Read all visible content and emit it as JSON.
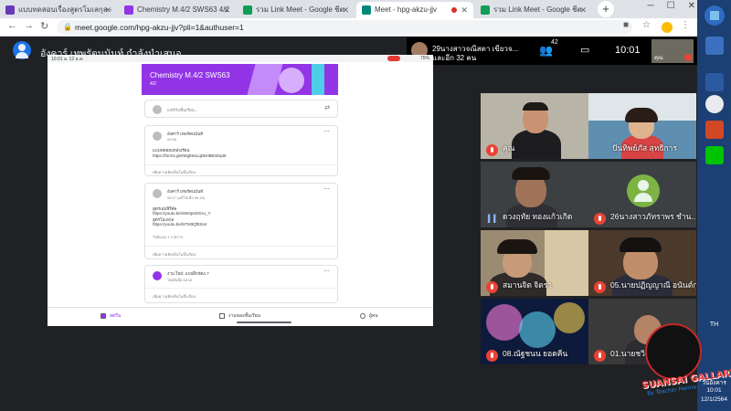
{
  "browser": {
    "tabs": [
      {
        "title": "แบบทดสอบเรื่องสูตรโมเลกุล - ",
        "favicon_color": "#673ab7"
      },
      {
        "title": "Chemistry M.4/2 SWS63 4/2",
        "favicon_color": "#9334e6"
      },
      {
        "title": "รวม Link Meet - Google ชีต",
        "favicon_color": "#0f9d58"
      },
      {
        "title": "Meet - hpg-akzu-jjv",
        "favicon_color": "#00897b",
        "active": true
      },
      {
        "title": "รวม Link Meet - Google ชีต",
        "favicon_color": "#0f9d58"
      }
    ],
    "new_tab": "+",
    "window_buttons": [
      "─",
      "☐",
      "✕"
    ],
    "url": "meet.google.com/hpg-akzu-jjv?pli=1&authuser=1"
  },
  "meet": {
    "presenter_label": "อังคาร์ เทพรัตนนันท์ กำลังนำเสนอ",
    "notification": {
      "line1": "29นางสาวจณีสตา เขียวจ...",
      "line2": "และอีก 32 คน"
    },
    "people_count": "42",
    "clock": "10:01",
    "self_name": "คุณ",
    "colors": {
      "background": "#202124",
      "mute": "#ea4335",
      "classroom_purple": "#9334e6"
    }
  },
  "shared_screen": {
    "status_left": "10:01 อ. 12 ธ.ค.",
    "status_right": "75%",
    "banner": {
      "title": "Chemistry M.4/2 SWS63",
      "subtitle": "4/2"
    },
    "share_prompt": "แชร์กับชั้นเรียน...",
    "posts": [
      {
        "author": "อังคาร์ เทพรัตนนันท์",
        "time": "09:08",
        "lines": [
          "แบบทดสอบหลังเรียน",
          "https://forms.gle/WgE6sLqD6H8B4Dq48"
        ],
        "comment": "เพิ่มความคิดเห็นในชั้นเรียน"
      },
      {
        "author": "อังคาร์ เทพรัตนนันท์",
        "time": "08:17 (แก้ไขเมื่อ 09:18)",
        "lines": [
          "สูตรเอมพิริคัล",
          "https://youtu.be/SW3pxDGzu_Y",
          "สูตรโมเลกุล",
          "https://youtu.be/NTM3Qf5Ss4"
        ],
        "attachment": "ไฟล์แนบ 1 รายการ",
        "comment": "เพิ่มความคิดเห็นในชั้นเรียน"
      },
      {
        "author": "งาน ใหม่: แบบฝึกหัด4.7",
        "time": "โพสต์เมื่อ 08:16",
        "comment": "เพิ่มความคิดเห็นในชั้นเรียน"
      }
    ],
    "bottom_nav": [
      "สตรีม",
      "งานของชั้นเรียน",
      "ผู้คน"
    ]
  },
  "participants": [
    {
      "name": "คุณ",
      "muted": true
    },
    {
      "name": "ปันทิพย์ภัส สุทธิการ",
      "muted": false
    },
    {
      "name": "ดวงฤทัย ทองแก้วเกิด",
      "muted": false,
      "speaking": true
    },
    {
      "name": "26นางสาวภัทราพร ชำน...",
      "muted": true,
      "avatar": true
    },
    {
      "name": "สมานจิต จิตรา",
      "muted": true
    },
    {
      "name": "05.นายปฏิญญาณี อนันต์กุล",
      "muted": true
    },
    {
      "name": "08.ณัฐชนน ยอดคีน",
      "muted": true
    },
    {
      "name": "01.นายชวิ...",
      "muted": true
    }
  ],
  "taskbar": {
    "language": "TH",
    "time": "10:01",
    "day": "วันอังคาร",
    "date": "12/1/2564"
  },
  "watermark": {
    "line1": "SUANSAI GALLARY",
    "line2": "By Teacher Hanna"
  }
}
